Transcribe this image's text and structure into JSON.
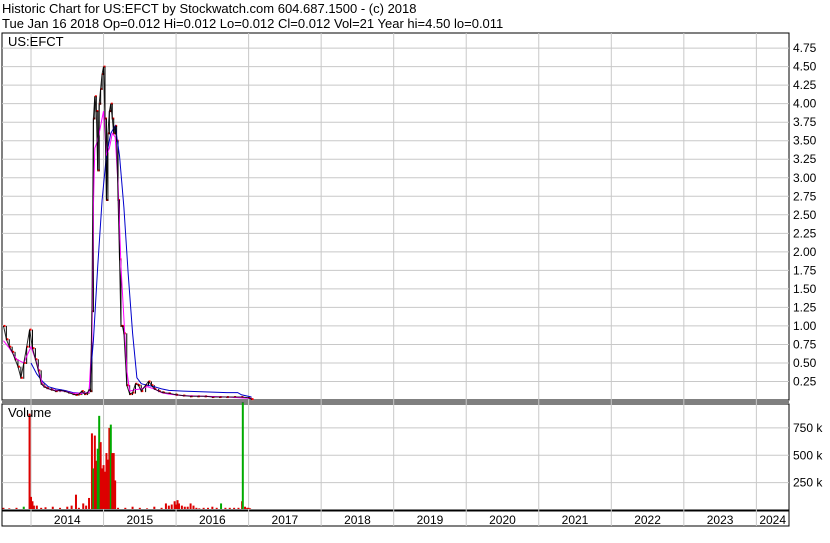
{
  "header": {
    "line1": "Historic Chart for US:EFCT by Stockwatch.com 604.687.1500 - (c) 2018",
    "line2": "Tue Jan 16 2018  Op=0.012  Hi=0.012  Lo=0.012  Cl=0.012  Vol=21  Year hi=4.50  lo=0.011"
  },
  "colors": {
    "background": "#ffffff",
    "grid": "#c8c8c8",
    "price_bar": "#000000",
    "price_up_tick": "#ff0000",
    "ma_short": "#ff00ff",
    "ma_long": "#0000cc",
    "volume_down": "#dd0000",
    "volume_up": "#00aa00"
  },
  "chart_data": [
    {
      "type": "line",
      "title": "US:EFCT",
      "ylim": [
        0,
        4.9
      ],
      "y_ticks": [
        "4.75",
        "4.50",
        "4.25",
        "4.00",
        "3.75",
        "3.50",
        "3.25",
        "3.00",
        "2.75",
        "2.50",
        "2.25",
        "2.00",
        "1.75",
        "1.50",
        "1.25",
        "1.00",
        "0.75",
        "0.50",
        "0.25"
      ],
      "x_ticks": [
        "2014",
        "2015",
        "2016",
        "2017",
        "2018",
        "2019",
        "2020",
        "2021",
        "2022",
        "2023",
        "2024"
      ],
      "x_range_years": [
        2013.6,
        2024.45
      ],
      "series": [
        {
          "key": "price",
          "points": [
            [
              2013.62,
              1.0
            ],
            [
              2013.66,
              0.82
            ],
            [
              2013.7,
              0.72
            ],
            [
              2013.74,
              0.65
            ],
            [
              2013.78,
              0.55
            ],
            [
              2013.82,
              0.45
            ],
            [
              2013.86,
              0.3
            ],
            [
              2013.9,
              0.5
            ],
            [
              2013.94,
              0.72
            ],
            [
              2013.98,
              0.95
            ],
            [
              2014.02,
              0.7
            ],
            [
              2014.06,
              0.55
            ],
            [
              2014.1,
              0.4
            ],
            [
              2014.14,
              0.22
            ],
            [
              2014.18,
              0.18
            ],
            [
              2014.22,
              0.16
            ],
            [
              2014.28,
              0.14
            ],
            [
              2014.34,
              0.12
            ],
            [
              2014.4,
              0.13
            ],
            [
              2014.46,
              0.12
            ],
            [
              2014.52,
              0.1
            ],
            [
              2014.58,
              0.08
            ],
            [
              2014.62,
              0.07
            ],
            [
              2014.66,
              0.08
            ],
            [
              2014.7,
              0.12
            ],
            [
              2014.74,
              0.08
            ],
            [
              2014.78,
              0.1
            ],
            [
              2014.8,
              0.14
            ],
            [
              2014.82,
              0.12
            ],
            [
              2014.84,
              1.2
            ],
            [
              2014.86,
              3.8
            ],
            [
              2014.88,
              4.1
            ],
            [
              2014.9,
              3.9
            ],
            [
              2014.92,
              3.1
            ],
            [
              2014.94,
              4.0
            ],
            [
              2014.96,
              4.2
            ],
            [
              2014.98,
              4.4
            ],
            [
              2015.0,
              4.5
            ],
            [
              2015.02,
              3.8
            ],
            [
              2015.04,
              2.7
            ],
            [
              2015.06,
              3.6
            ],
            [
              2015.08,
              3.9
            ],
            [
              2015.1,
              4.0
            ],
            [
              2015.12,
              3.8
            ],
            [
              2015.14,
              3.6
            ],
            [
              2015.16,
              3.7
            ],
            [
              2015.18,
              3.5
            ],
            [
              2015.2,
              2.7
            ],
            [
              2015.22,
              1.9
            ],
            [
              2015.24,
              1.0
            ],
            [
              2015.26,
              1.0
            ],
            [
              2015.28,
              0.9
            ],
            [
              2015.32,
              0.2
            ],
            [
              2015.36,
              0.08
            ],
            [
              2015.4,
              0.1
            ],
            [
              2015.44,
              0.22
            ],
            [
              2015.48,
              0.2
            ],
            [
              2015.52,
              0.12
            ],
            [
              2015.58,
              0.2
            ],
            [
              2015.62,
              0.25
            ],
            [
              2015.66,
              0.2
            ],
            [
              2015.7,
              0.15
            ],
            [
              2015.76,
              0.12
            ],
            [
              2015.82,
              0.1
            ],
            [
              2015.9,
              0.09
            ],
            [
              2016.0,
              0.07
            ],
            [
              2016.1,
              0.06
            ],
            [
              2016.2,
              0.05
            ],
            [
              2016.3,
              0.05
            ],
            [
              2016.4,
              0.05
            ],
            [
              2016.5,
              0.04
            ],
            [
              2016.6,
              0.04
            ],
            [
              2016.7,
              0.04
            ],
            [
              2016.8,
              0.04
            ],
            [
              2016.9,
              0.04
            ],
            [
              2017.0,
              0.03
            ],
            [
              2017.04,
              0.012
            ]
          ]
        },
        {
          "key": "ma_short",
          "name": "",
          "points": [
            [
              2013.62,
              0.8
            ],
            [
              2013.7,
              0.7
            ],
            [
              2013.8,
              0.55
            ],
            [
              2013.9,
              0.5
            ],
            [
              2014.0,
              0.72
            ],
            [
              2014.08,
              0.5
            ],
            [
              2014.16,
              0.2
            ],
            [
              2014.24,
              0.15
            ],
            [
              2014.34,
              0.13
            ],
            [
              2014.46,
              0.12
            ],
            [
              2014.58,
              0.09
            ],
            [
              2014.7,
              0.09
            ],
            [
              2014.8,
              0.1
            ],
            [
              2014.84,
              0.8
            ],
            [
              2014.86,
              2.6
            ],
            [
              2014.88,
              3.4
            ],
            [
              2014.92,
              3.5
            ],
            [
              2014.96,
              3.7
            ],
            [
              2015.0,
              3.9
            ],
            [
              2015.04,
              3.3
            ],
            [
              2015.08,
              3.4
            ],
            [
              2015.12,
              3.6
            ],
            [
              2015.16,
              3.55
            ],
            [
              2015.2,
              2.9
            ],
            [
              2015.24,
              1.8
            ],
            [
              2015.28,
              1.1
            ],
            [
              2015.32,
              0.4
            ],
            [
              2015.36,
              0.12
            ],
            [
              2015.44,
              0.14
            ],
            [
              2015.52,
              0.15
            ],
            [
              2015.6,
              0.18
            ],
            [
              2015.7,
              0.15
            ],
            [
              2015.8,
              0.1
            ],
            [
              2015.9,
              0.08
            ],
            [
              2016.1,
              0.06
            ],
            [
              2016.4,
              0.05
            ],
            [
              2016.7,
              0.04
            ],
            [
              2017.04,
              0.02
            ]
          ]
        },
        {
          "key": "ma_long",
          "name": "",
          "points": [
            [
              2014.0,
              0.5
            ],
            [
              2014.08,
              0.35
            ],
            [
              2014.16,
              0.25
            ],
            [
              2014.24,
              0.18
            ],
            [
              2014.34,
              0.15
            ],
            [
              2014.46,
              0.13
            ],
            [
              2014.58,
              0.1
            ],
            [
              2014.7,
              0.09
            ],
            [
              2014.8,
              0.1
            ],
            [
              2014.86,
              0.8
            ],
            [
              2014.92,
              1.8
            ],
            [
              2014.98,
              2.7
            ],
            [
              2015.04,
              3.3
            ],
            [
              2015.1,
              3.6
            ],
            [
              2015.16,
              3.7
            ],
            [
              2015.22,
              3.3
            ],
            [
              2015.28,
              2.6
            ],
            [
              2015.34,
              1.7
            ],
            [
              2015.4,
              0.9
            ],
            [
              2015.46,
              0.3
            ],
            [
              2015.52,
              0.22
            ],
            [
              2015.6,
              0.2
            ],
            [
              2015.7,
              0.18
            ],
            [
              2015.8,
              0.15
            ],
            [
              2015.9,
              0.13
            ],
            [
              2016.1,
              0.12
            ],
            [
              2016.4,
              0.11
            ],
            [
              2016.7,
              0.1
            ],
            [
              2016.85,
              0.1
            ],
            [
              2016.9,
              0.07
            ],
            [
              2017.04,
              0.04
            ]
          ]
        }
      ]
    },
    {
      "type": "bar",
      "title": "Volume",
      "ylim": [
        0,
        950
      ],
      "y_ticks": [
        "750 k",
        "500 k",
        "250 k"
      ],
      "unit": "k",
      "bars": [
        [
          2013.62,
          20,
          "d"
        ],
        [
          2013.7,
          15,
          "d"
        ],
        [
          2013.8,
          20,
          "d"
        ],
        [
          2013.9,
          30,
          "u"
        ],
        [
          2013.98,
          880,
          "d"
        ],
        [
          2014.0,
          120,
          "d"
        ],
        [
          2014.02,
          80,
          "d"
        ],
        [
          2014.04,
          40,
          "d"
        ],
        [
          2014.08,
          40,
          "d"
        ],
        [
          2014.14,
          20,
          "d"
        ],
        [
          2014.2,
          25,
          "d"
        ],
        [
          2014.3,
          30,
          "d"
        ],
        [
          2014.4,
          20,
          "d"
        ],
        [
          2014.5,
          30,
          "d"
        ],
        [
          2014.56,
          40,
          "d"
        ],
        [
          2014.62,
          140,
          "d"
        ],
        [
          2014.66,
          20,
          "d"
        ],
        [
          2014.72,
          60,
          "d"
        ],
        [
          2014.76,
          40,
          "d"
        ],
        [
          2014.8,
          110,
          "d"
        ],
        [
          2014.84,
          700,
          "d"
        ],
        [
          2014.86,
          380,
          "u"
        ],
        [
          2014.88,
          680,
          "d"
        ],
        [
          2014.9,
          450,
          "d"
        ],
        [
          2014.92,
          560,
          "u"
        ],
        [
          2014.94,
          860,
          "u"
        ],
        [
          2014.96,
          620,
          "d"
        ],
        [
          2014.98,
          380,
          "d"
        ],
        [
          2015.0,
          410,
          "d"
        ],
        [
          2015.02,
          350,
          "d"
        ],
        [
          2015.04,
          520,
          "d"
        ],
        [
          2015.06,
          460,
          "d"
        ],
        [
          2015.08,
          750,
          "d"
        ],
        [
          2015.1,
          780,
          "u"
        ],
        [
          2015.12,
          520,
          "d"
        ],
        [
          2015.14,
          520,
          "d"
        ],
        [
          2015.16,
          270,
          "d"
        ],
        [
          2015.2,
          20,
          "d"
        ],
        [
          2015.3,
          20,
          "d"
        ],
        [
          2015.4,
          30,
          "d"
        ],
        [
          2015.5,
          20,
          "d"
        ],
        [
          2015.6,
          15,
          "d"
        ],
        [
          2015.7,
          30,
          "d"
        ],
        [
          2015.8,
          20,
          "d"
        ],
        [
          2015.86,
          60,
          "d"
        ],
        [
          2015.9,
          40,
          "d"
        ],
        [
          2015.94,
          50,
          "d"
        ],
        [
          2015.98,
          80,
          "d"
        ],
        [
          2016.0,
          50,
          "d"
        ],
        [
          2016.02,
          90,
          "d"
        ],
        [
          2016.04,
          60,
          "d"
        ],
        [
          2016.08,
          40,
          "d"
        ],
        [
          2016.12,
          30,
          "d"
        ],
        [
          2016.16,
          30,
          "d"
        ],
        [
          2016.2,
          60,
          "d"
        ],
        [
          2016.24,
          40,
          "d"
        ],
        [
          2016.28,
          20,
          "d"
        ],
        [
          2016.32,
          15,
          "d"
        ],
        [
          2016.38,
          20,
          "d"
        ],
        [
          2016.44,
          20,
          "d"
        ],
        [
          2016.5,
          30,
          "d"
        ],
        [
          2016.56,
          20,
          "d"
        ],
        [
          2016.62,
          60,
          "u"
        ],
        [
          2016.68,
          20,
          "d"
        ],
        [
          2016.74,
          20,
          "d"
        ],
        [
          2016.8,
          20,
          "d"
        ],
        [
          2016.86,
          20,
          "d"
        ],
        [
          2016.91,
          80,
          "d"
        ],
        [
          2016.92,
          980,
          "u"
        ],
        [
          2016.95,
          30,
          "d"
        ],
        [
          2016.98,
          20,
          "d"
        ],
        [
          2017.0,
          20,
          "d"
        ],
        [
          2017.02,
          15,
          "d"
        ]
      ]
    }
  ]
}
